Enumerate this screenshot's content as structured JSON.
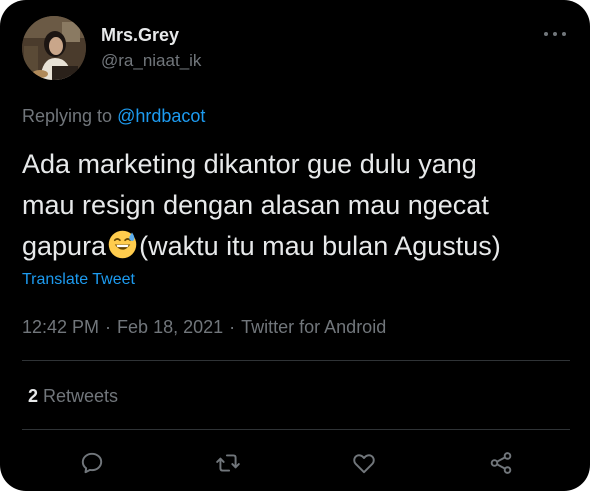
{
  "user": {
    "display_name": "Mrs.Grey",
    "handle": "@ra_niaat_ik"
  },
  "reply": {
    "prefix": "Replying to",
    "mention": "@hrdbacot"
  },
  "tweet": {
    "line1": "Ada marketing dikantor gue dulu yang",
    "line2": "mau resign dengan alasan mau ngecat",
    "line3_before_emoji": "gapura",
    "emoji": "grinning-face-with-sweat",
    "line3_after_emoji": "(waktu itu mau bulan Agustus)"
  },
  "translate_label": "Translate Tweet",
  "meta": {
    "time": "12:42 PM",
    "date": "Feb 18, 2021",
    "source": "Twitter for Android",
    "separator": "·"
  },
  "stats": {
    "retweets_count": "2",
    "retweets_label": "Retweets"
  },
  "actions": [
    "reply-icon",
    "retweet-icon",
    "like-icon",
    "share-icon"
  ],
  "colors": {
    "background": "#000000",
    "text_primary": "#e7e9ea",
    "text_secondary": "#71767b",
    "accent": "#1d9bf0",
    "divider": "#2f3336"
  }
}
